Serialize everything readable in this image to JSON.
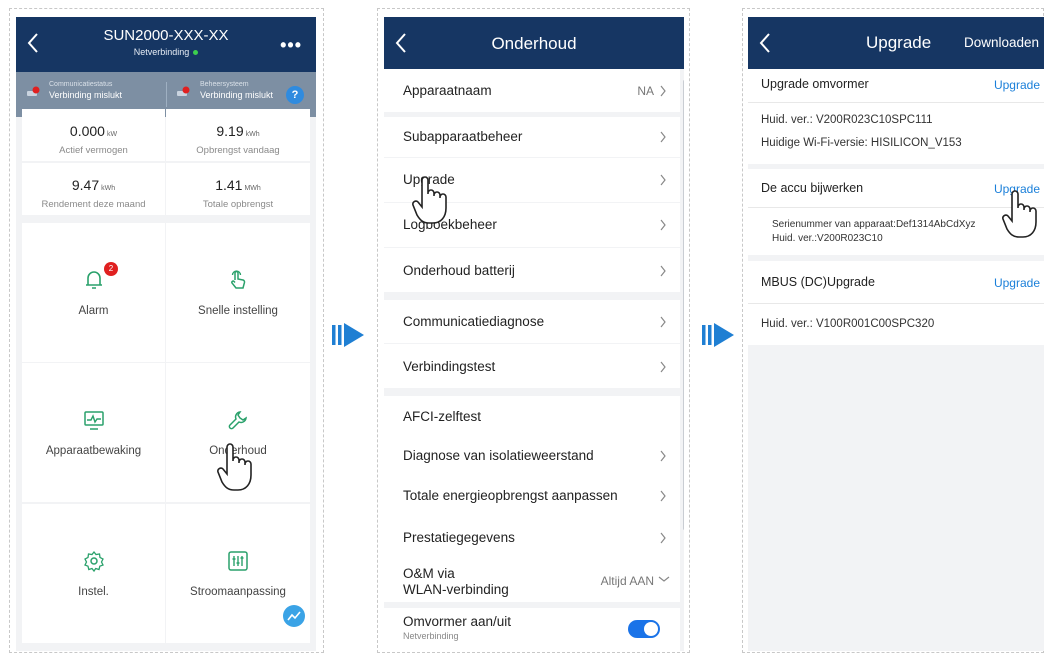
{
  "panel1": {
    "title": "SUN2000-XXX-XX",
    "subtitle": "Netverbinding",
    "more": "•••",
    "status": [
      {
        "label": "Communicatiestatus",
        "value": "Verbinding mislukt"
      },
      {
        "label": "Beheersysteem",
        "value": "Verbinding mislukt"
      }
    ],
    "help": "?",
    "kpis": [
      {
        "value": "0.000",
        "unit": "kW",
        "caption": "Actief vermogen"
      },
      {
        "value": "9.19",
        "unit": "kWh",
        "caption": "Opbrengst vandaag"
      },
      {
        "value": "9.47",
        "unit": "kWh",
        "caption": "Rendement deze maand"
      },
      {
        "value": "1.41",
        "unit": "MWh",
        "caption": "Totale opbrengst"
      }
    ],
    "tiles": [
      {
        "label": "Alarm",
        "icon": "bell-icon",
        "badge": "2"
      },
      {
        "label": "Snelle instelling",
        "icon": "tap-icon"
      },
      {
        "label": "Apparaatbewaking",
        "icon": "monitor-icon"
      },
      {
        "label": "Onderhoud",
        "icon": "wrench-icon"
      },
      {
        "label": "Instel.",
        "icon": "gear-icon"
      },
      {
        "label": "Stroomaanpassing",
        "icon": "sliders-icon"
      }
    ]
  },
  "panel2": {
    "title": "Onderhoud",
    "rows": [
      {
        "label": "Apparaatnaam",
        "value": "NA"
      },
      {
        "label": "Subapparaatbeheer"
      },
      {
        "label": "Upgrade"
      },
      {
        "label": "Logboekbeheer"
      },
      {
        "label": "Onderhoud batterij"
      },
      {
        "label": "Communicatiediagnose"
      },
      {
        "label": "Verbindingstest"
      },
      {
        "label": "AFCI-zelftest"
      },
      {
        "label": "Diagnose van isolatieweerstand"
      },
      {
        "label": "Totale energieopbrengst aanpassen"
      },
      {
        "label": "Prestatiegegevens"
      },
      {
        "label_line1": "O&M via",
        "label_line2": "WLAN-verbinding",
        "value": "Altijd AAN"
      },
      {
        "label": "Omvormer aan/uit",
        "sub": "Netverbinding"
      }
    ]
  },
  "panel3": {
    "title": "Upgrade",
    "download": "Downloaden",
    "sections": [
      {
        "title": "Upgrade omvormer",
        "action": "Upgrade",
        "lines": [
          "Huid. ver.: V200R023C10SPC111",
          "Huidige Wi-Fi-versie: HISILICON_V153"
        ]
      },
      {
        "title": "De accu bijwerken",
        "action": "Upgrade",
        "lines": [
          "Serienummer van apparaat:Def1314AbCdXyz",
          "Huid. ver.:V200R023C10"
        ]
      },
      {
        "title": "MBUS (DC)Upgrade",
        "action": "Upgrade",
        "lines": [
          "Huid. ver.: V100R001C00SPC320"
        ]
      }
    ]
  },
  "colors": {
    "header": "#163663",
    "status": "#7d8fa3",
    "accent": "#1a7fd9",
    "arrow": "#1f7fd3"
  }
}
